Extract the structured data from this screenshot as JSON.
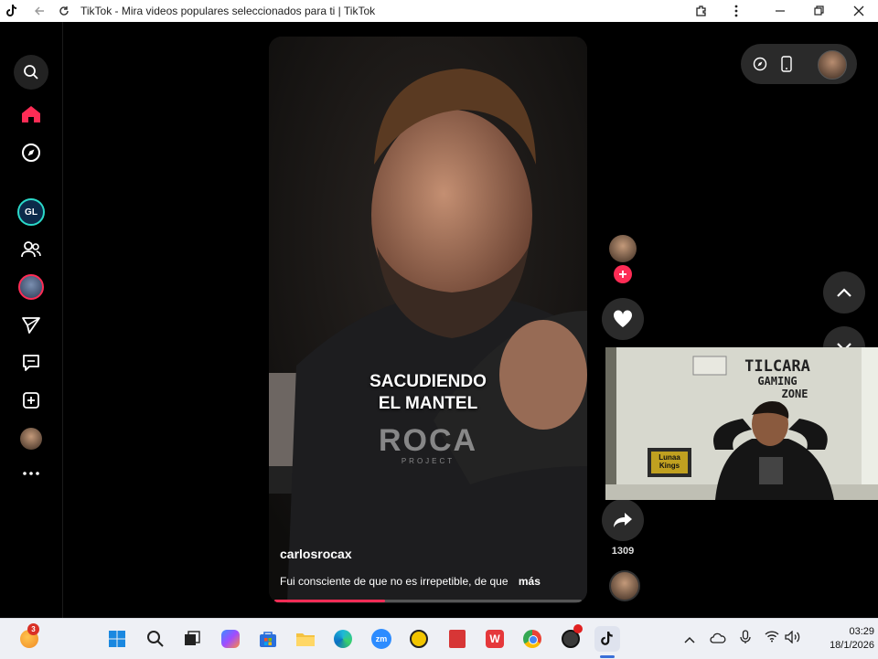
{
  "window": {
    "title": "TikTok - Mira videos populares seleccionados para ti | TikTok"
  },
  "video": {
    "overlay_line1": "SACUDIENDO",
    "overlay_line2": "EL MANTEL",
    "brand_logo_text": "ROCA",
    "brand_logo_sub": "PROJECT",
    "author": "carlosrocax",
    "caption": "Fui consciente de que no es irrepetible, de que",
    "more_label": "más",
    "progress_fraction": 0.36
  },
  "actions": {
    "share_count": "1309"
  },
  "webcam": {
    "sign_line1": "TILCARA",
    "sign_line2": "GAMING",
    "sign_line3": "ZONE",
    "box_label": "Lunaa Kings"
  },
  "taskbar": {
    "weather_badge": "3",
    "time": "03:29",
    "date": "18/1/2026"
  },
  "colors": {
    "tiktok_accent": "#fe2c55",
    "progress_fill": "#fe2c55"
  }
}
